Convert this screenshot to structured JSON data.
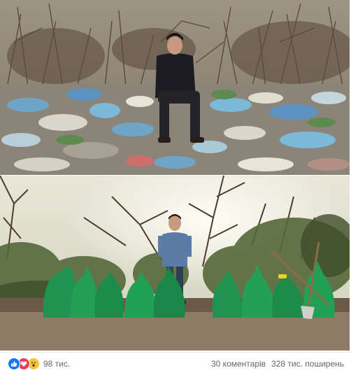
{
  "post": {
    "photos": [
      {
        "alt_label": "before-cleanup-photo"
      },
      {
        "alt_label": "after-cleanup-photo"
      }
    ],
    "reactions": {
      "icons": [
        "like-icon",
        "love-icon",
        "wow-icon"
      ],
      "colors": {
        "like": "#1877f2",
        "love": "#f33e58",
        "wow": "#f7c33c"
      },
      "count": "98 тис."
    },
    "comments": "30 коментарів",
    "shares": "328 тис. поширень"
  }
}
